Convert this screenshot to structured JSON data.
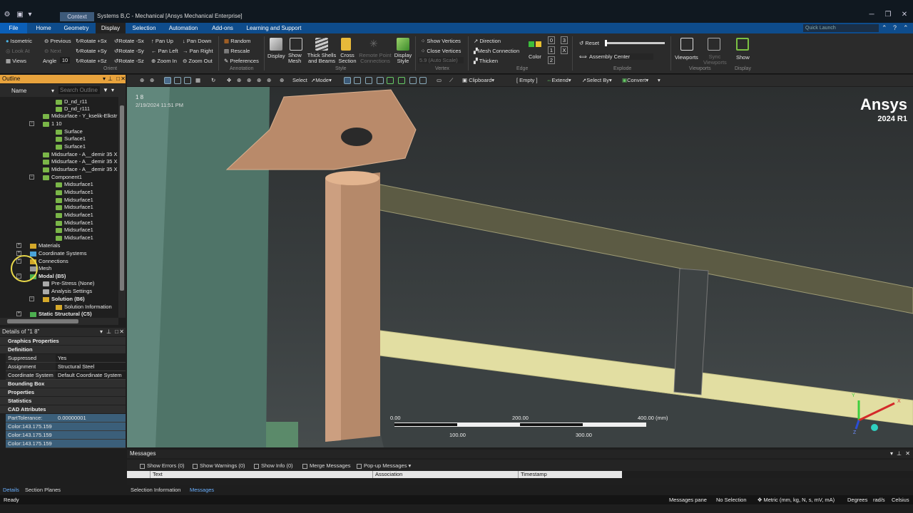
{
  "titlebar": {
    "context_tab": "Context",
    "title": "Systems B,C - Mechanical [Ansys Mechanical Enterprise]"
  },
  "menu": {
    "tabs": [
      "File",
      "Home",
      "Geometry",
      "Display",
      "Selection",
      "Automation",
      "Add-ons",
      "Learning and Support"
    ],
    "active": "Display",
    "quick_launch": "Quick Launch"
  },
  "ribbon": {
    "orient": {
      "isometric": "Isometric",
      "previous": "Previous",
      "look_at": "Look At",
      "next": "Next",
      "angle_label": "Angle",
      "angle_value": "10",
      "views": "Views",
      "rot_psx": "Rotate +Sx",
      "rot_msx": "Rotate -Sx",
      "rot_psy": "Rotate +Sy",
      "rot_msy": "Rotate -Sy",
      "rot_psz": "Rotate +Sz",
      "rot_msz": "Rotate -Sz",
      "pan_up": "Pan Up",
      "pan_down": "Pan Down",
      "pan_left": "Pan Left",
      "pan_right": "Pan Right",
      "zoom_in": "Zoom In",
      "zoom_out": "Zoom Out",
      "group": "Orient"
    },
    "annotation": {
      "random": "Random",
      "rescale": "Rescale",
      "preferences": "Preferences",
      "group": "Annotation"
    },
    "style": {
      "display": "Display",
      "show_mesh": "Show Mesh",
      "thick_shells": "Thick Shells and Beams",
      "cross_section": "Cross Section",
      "remote_point": "Remote Point Connections",
      "display_style": "Display Style",
      "group": "Style"
    },
    "vertex": {
      "show_vertices": "Show Vertices",
      "close_vertices": "Close Vertices",
      "auto_scale": "5.9 (Auto Scale)",
      "group": "Vertex"
    },
    "edge": {
      "direction": "Direction",
      "mesh_connection": "Mesh Connection",
      "thicken": "Thicken",
      "color": "Color",
      "n0": "0",
      "n1": "1",
      "n2": "2",
      "n3": "3",
      "x": "X",
      "group": "Edge"
    },
    "explode": {
      "reset": "Reset",
      "assembly_center": "Assembly Center",
      "group": "Explode"
    },
    "viewports": {
      "viewports": "Viewports",
      "sync": "Sync Viewports",
      "group": "Viewports"
    },
    "display_grp": {
      "show": "Show",
      "group": "Display"
    }
  },
  "gtoolbar": {
    "select": "Select",
    "mode": "Mode",
    "clipboard": "Clipboard",
    "empty": "[ Empty ]",
    "extend": "Extend",
    "select_by": "Select By",
    "convert": "Convert"
  },
  "outline": {
    "title": "Outline",
    "col_name": "Name",
    "search_placeholder": "Search Outline",
    "nodes": [
      "D_nd_r11",
      "D_nd_r111",
      "Midsurface - Y_kselik-Elkstr",
      "1 10",
      "Surface",
      "Surface1",
      "Surface1",
      "Midsurface - A__demir 35 X",
      "Midsurface - A__demir 35 X",
      "Midsurface - A__demir 35 X",
      "Component1",
      "Midsurface1",
      "Midsurface1",
      "Midsurface1",
      "Midsurface1",
      "Midsurface1",
      "Midsurface1",
      "Midsurface1",
      "Midsurface1",
      "Materials",
      "Coordinate Systems",
      "Connections",
      "Mesh",
      "Modal (B5)",
      "Pre-Stress (None)",
      "Analysis Settings",
      "Solution (B6)",
      "Solution Information",
      "Static Structural (C5)"
    ]
  },
  "details": {
    "title": "Details of \"1 8\"",
    "sections": {
      "graphics": "Graphics Properties",
      "definition": "Definition",
      "bounding": "Bounding Box",
      "properties": "Properties",
      "statistics": "Statistics",
      "cad": "CAD Attributes"
    },
    "rows": {
      "suppressed_k": "Suppressed",
      "suppressed_v": "Yes",
      "assignment_k": "Assignment",
      "assignment_v": "Structural Steel",
      "coord_k": "Coordinate System",
      "coord_v": "Default Coordinate System",
      "tol_k": "PartTolerance:",
      "tol_v": "0.00000001",
      "color1": "Color:143.175.159",
      "color2": "Color:143.175.159",
      "color3": "Color:143.175.159"
    }
  },
  "viewport": {
    "label": "1 8",
    "timestamp": "2/19/2024 11:51 PM",
    "brand": "Ansys",
    "version": "2024 R1",
    "scale": {
      "t0": "0.00",
      "t100": "100.00",
      "t200": "200.00",
      "t300": "300.00",
      "t400": "400.00 (mm)"
    },
    "axis_x": "X",
    "axis_y": "Y",
    "axis_z": "Z"
  },
  "messages": {
    "title": "Messages",
    "show_errors": "Show Errors",
    "errors_count": "(0)",
    "show_warnings": "Show Warnings",
    "warnings_count": "(0)",
    "show_info": "Show Info",
    "info_count": "(0)",
    "merge": "Merge Messages",
    "popup": "Pop-up Messages",
    "col_text": "Text",
    "col_assoc": "Association",
    "col_time": "Timestamp"
  },
  "bottom_tabs": {
    "details": "Details",
    "section_planes": "Section Planes",
    "selection_info": "Selection Information",
    "messages": "Messages"
  },
  "status": {
    "ready": "Ready",
    "pane": "Messages pane",
    "selection": "No Selection",
    "units": "Metric (mm, kg, N, s, mV, mA)",
    "degrees": "Degrees",
    "rads": "rad/s",
    "temp": "Celsius"
  },
  "colors": {
    "menu_blue": "#0e4c8c",
    "outline_orange": "#e8a33d",
    "part_bronze": "#b98a6a",
    "beam_yellow": "#e6e2a6",
    "beam_olive": "#5e5d45",
    "column_green": "#5a8377"
  }
}
